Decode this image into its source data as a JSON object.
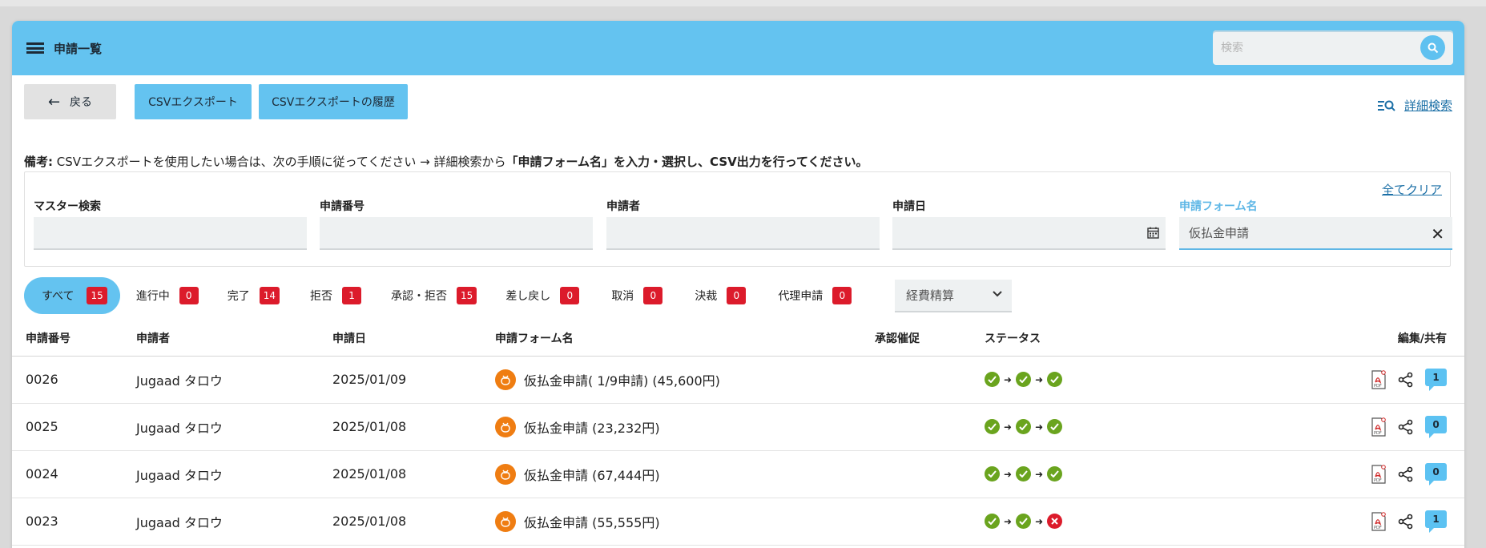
{
  "header": {
    "title": "申請一覧",
    "search_placeholder": "検索"
  },
  "toolbar": {
    "back_label": "戻る",
    "csv_export_label": "CSVエクスポート",
    "csv_history_label": "CSVエクスポートの履歴",
    "advanced_search_label": "詳細検索"
  },
  "note": {
    "prefix": "備考:",
    "text": " CSVエクスポートを使用したい場合は、次の手順に従ってください → 詳細検索から",
    "emphasis": "「申請フォーム名」を入力・選択し、CSV出力を行ってください。"
  },
  "filters": {
    "clear_all_label": "全てクリア",
    "master_search_label": "マスター検索",
    "application_no_label": "申請番号",
    "applicant_label": "申請者",
    "date_label": "申請日",
    "form_name_label": "申請フォーム名",
    "form_name_value": "仮払金申請"
  },
  "tabs": [
    {
      "label": "すべて",
      "count": "15"
    },
    {
      "label": "進行中",
      "count": "0"
    },
    {
      "label": "完了",
      "count": "14"
    },
    {
      "label": "拒否",
      "count": "1"
    },
    {
      "label": "承認・拒否",
      "count": "15"
    },
    {
      "label": "差し戻し",
      "count": "0"
    },
    {
      "label": "取消",
      "count": "0"
    },
    {
      "label": "決裁",
      "count": "0"
    },
    {
      "label": "代理申請",
      "count": "0"
    }
  ],
  "category_select": {
    "value": "経費精算"
  },
  "table": {
    "columns": [
      "申請番号",
      "申請者",
      "申請日",
      "申請フォーム名",
      "承認催促",
      "ステータス",
      "編集/共有"
    ],
    "rows": [
      {
        "no": "0026",
        "applicant": "Jugaad タロウ",
        "date": "2025/01/09",
        "form": "仮払金申請( 1/9申請) (45,600円)",
        "status": [
          "ok",
          "ok",
          "ok"
        ],
        "comments": "1"
      },
      {
        "no": "0025",
        "applicant": "Jugaad タロウ",
        "date": "2025/01/08",
        "form": "仮払金申請 (23,232円)",
        "status": [
          "ok",
          "ok",
          "ok"
        ],
        "comments": "0"
      },
      {
        "no": "0024",
        "applicant": "Jugaad タロウ",
        "date": "2025/01/08",
        "form": "仮払金申請 (67,444円)",
        "status": [
          "ok",
          "ok",
          "ok"
        ],
        "comments": "0"
      },
      {
        "no": "0023",
        "applicant": "Jugaad タロウ",
        "date": "2025/01/08",
        "form": "仮払金申請 (55,555円)",
        "status": [
          "ok",
          "ok",
          "ng"
        ],
        "comments": "1"
      }
    ]
  },
  "colors": {
    "header": "#64c3f0",
    "badge": "#dc1b2b",
    "status_ok": "#6aa41e",
    "status_ng": "#dc1b2b",
    "form_icon": "#ef7d12",
    "link": "#1b6fa6"
  }
}
